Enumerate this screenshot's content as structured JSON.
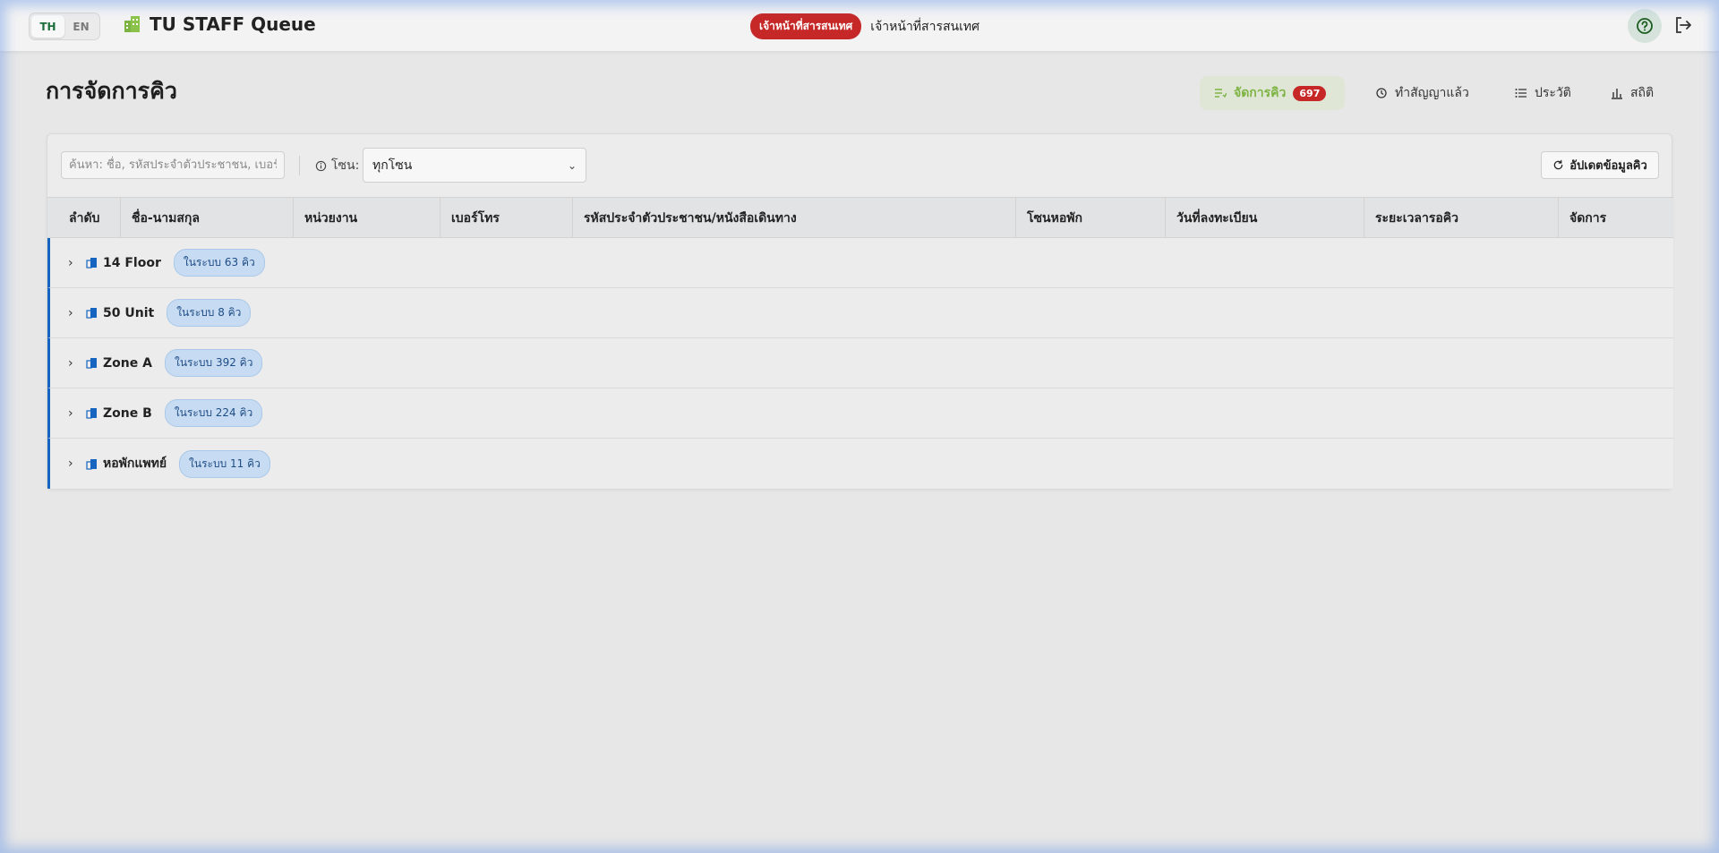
{
  "header": {
    "lang": {
      "th": "TH",
      "en": "EN",
      "active": "TH"
    },
    "app_title": "TU STAFF Queue",
    "role_badge": "เจ้าหน้าที่สารสนเทศ",
    "role_name": "เจ้าหน้าที่สารสนเทศ",
    "help_icon": "help-circle-icon",
    "logout_icon": "logout-icon",
    "brand_color": "#7cb342",
    "role_color": "#c62828"
  },
  "page": {
    "title": "การจัดการคิว"
  },
  "tabs": [
    {
      "label": "จัดการคิว",
      "badge": "697",
      "icon": "queue-list-icon",
      "active": true
    },
    {
      "label": "ทำสัญญาแล้ว",
      "icon": "history-icon",
      "active": false
    },
    {
      "label": "ประวัติ",
      "icon": "list-icon",
      "active": false
    },
    {
      "label": "สถิติ",
      "icon": "bar-chart-icon",
      "active": false
    }
  ],
  "filters": {
    "search_placeholder": "ค้นหา: ชื่อ, รหัสประจำตัวประชาชน, เบอร์โทร",
    "zone_label": "โซน:",
    "zone_value": "ทุกโซน",
    "refresh_label": "อัปเดตข้อมูลคิว"
  },
  "table": {
    "columns": [
      "ลำดับ",
      "ชื่อ-นามสกุล",
      "หน่วยงาน",
      "เบอร์โทร",
      "รหัสประจำตัวประชาชน/หนังสือเดินทาง",
      "โซนหอพัก",
      "วันที่ลงทะเบียน",
      "ระยะเวลารอคิว",
      "จัดการ"
    ],
    "groups": [
      {
        "name": "14 Floor",
        "count": "ในระบบ 63 คิว"
      },
      {
        "name": "50 Unit",
        "count": "ในระบบ 8 คิว"
      },
      {
        "name": "Zone A",
        "count": "ในระบบ 392 คิว"
      },
      {
        "name": "Zone B",
        "count": "ในระบบ 224 คิว"
      },
      {
        "name": "หอพักแพทย์",
        "count": "ในระบบ 11 คิว"
      }
    ],
    "group_accent": "#1565c0"
  }
}
